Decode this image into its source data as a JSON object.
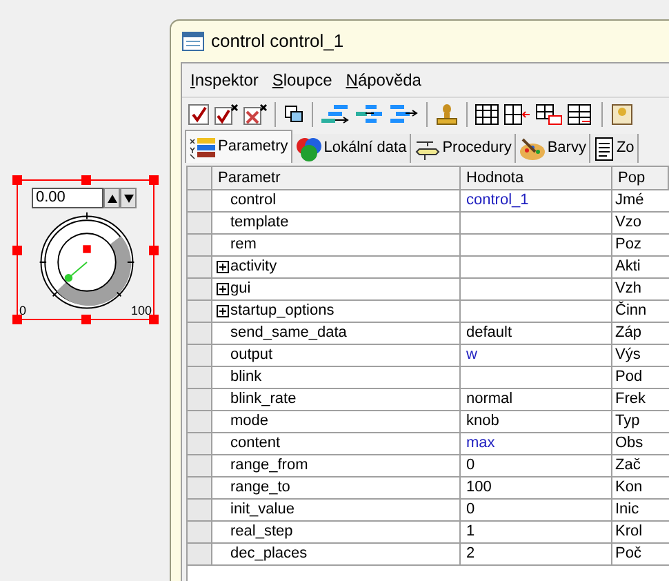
{
  "widget": {
    "value": "0.00",
    "scale_min": "0",
    "scale_max": "100"
  },
  "window": {
    "title": "control control_1"
  },
  "menu": [
    "Inspektor",
    "Sloupce",
    "Nápověda"
  ],
  "tabs": [
    {
      "label": "Parametry",
      "selected": true
    },
    {
      "label": "Lokální data",
      "selected": false
    },
    {
      "label": "Procedury",
      "selected": false
    },
    {
      "label": "Barvy",
      "selected": false
    },
    {
      "label": "Zo",
      "selected": false
    }
  ],
  "table": {
    "columns": [
      "Parametr",
      "Hodnota",
      "Pop"
    ],
    "rows": [
      {
        "param": "control",
        "value": "control_1",
        "linked": true,
        "expandable": false,
        "description": "Jmé"
      },
      {
        "param": "template",
        "expandable": false,
        "description": "Vzo"
      },
      {
        "param": "rem",
        "expandable": false,
        "description": "Poz"
      },
      {
        "param": "activity",
        "expandable": true,
        "description": "Akti"
      },
      {
        "param": "gui",
        "expandable": true,
        "description": "Vzh"
      },
      {
        "param": "startup_options",
        "expandable": true,
        "description": "Činn"
      },
      {
        "param": "send_same_data",
        "value": "default",
        "linked": false,
        "expandable": false,
        "description": "Záp"
      },
      {
        "param": "output",
        "value": "w",
        "linked": true,
        "expandable": false,
        "description": "Výs"
      },
      {
        "param": "blink",
        "expandable": false,
        "description": "Pod"
      },
      {
        "param": "blink_rate",
        "value": "normal",
        "linked": false,
        "expandable": false,
        "description": "Frek"
      },
      {
        "param": "mode",
        "value": "knob",
        "linked": false,
        "expandable": false,
        "description": "Typ"
      },
      {
        "param": "content",
        "value": "max",
        "linked": true,
        "expandable": false,
        "description": "Obs"
      },
      {
        "param": "range_from",
        "value": "0",
        "linked": false,
        "expandable": false,
        "description": "Zač"
      },
      {
        "param": "range_to",
        "value": "100",
        "linked": false,
        "expandable": false,
        "description": "Kon"
      },
      {
        "param": "init_value",
        "value": "0",
        "linked": false,
        "expandable": false,
        "description": "Inic"
      },
      {
        "param": "real_step",
        "value": "1",
        "linked": false,
        "expandable": false,
        "description": "Krol"
      },
      {
        "param": "dec_places",
        "value": "2",
        "linked": false,
        "expandable": false,
        "description": "Poč"
      }
    ]
  }
}
